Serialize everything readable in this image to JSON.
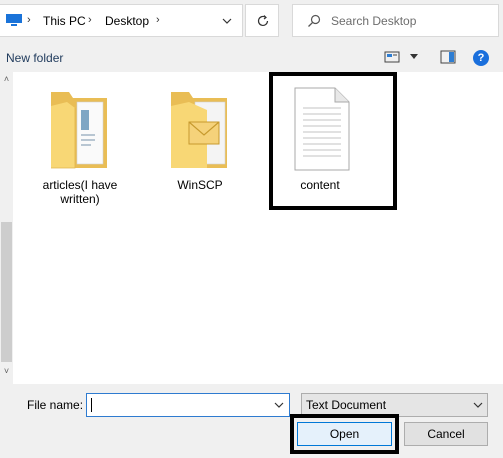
{
  "address_bar": {
    "breadcrumbs": [
      "This PC",
      "Desktop"
    ]
  },
  "search": {
    "placeholder": "Search Desktop"
  },
  "toolbar": {
    "new_folder_label": "New folder",
    "help_label": "?"
  },
  "files": [
    {
      "name": "articles(I have written)",
      "type": "folder-with-documents"
    },
    {
      "name": "WinSCP",
      "type": "folder-with-envelope"
    },
    {
      "name": "content",
      "type": "text-document",
      "highlighted": true
    }
  ],
  "bottom": {
    "file_name_label": "File name:",
    "file_name_value": "",
    "file_type_value": "Text Document",
    "open_label": "Open",
    "cancel_label": "Cancel"
  },
  "colors": {
    "accent": "#0078d7",
    "folder": "#f8d775",
    "highlight_border": "#000000"
  }
}
